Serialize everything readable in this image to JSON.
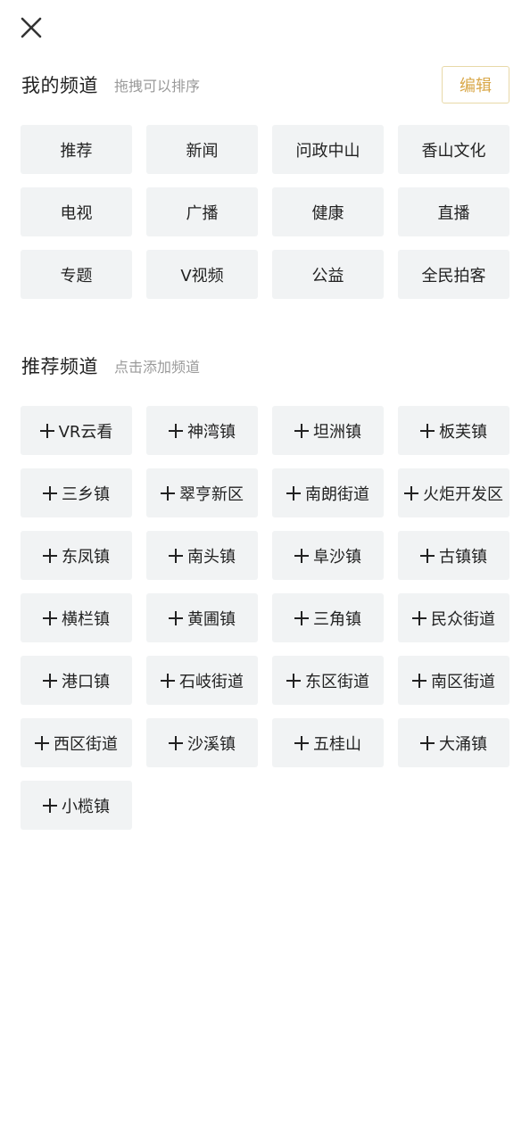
{
  "my_channels": {
    "title": "我的频道",
    "hint": "拖拽可以排序",
    "edit_label": "编辑",
    "items": [
      "推荐",
      "新闻",
      "问政中山",
      "香山文化",
      "电视",
      "广播",
      "健康",
      "直播",
      "专题",
      "V视频",
      "公益",
      "全民拍客"
    ]
  },
  "recommended_channels": {
    "title": "推荐频道",
    "hint": "点击添加频道",
    "items": [
      "VR云看",
      "神湾镇",
      "坦洲镇",
      "板芙镇",
      "三乡镇",
      "翠亨新区",
      "南朗街道",
      "火炬开发区",
      "东凤镇",
      "南头镇",
      "阜沙镇",
      "古镇镇",
      "横栏镇",
      "黄圃镇",
      "三角镇",
      "民众街道",
      "港口镇",
      "石岐街道",
      "东区街道",
      "南区街道",
      "西区街道",
      "沙溪镇",
      "五桂山",
      "大涌镇",
      "小榄镇"
    ]
  },
  "icons": {
    "close": "close-icon",
    "add": "plus-icon"
  },
  "colors": {
    "accent": "#d9a84a",
    "chip_bg": "#f1f3f4",
    "hint": "#9a9a9a"
  }
}
